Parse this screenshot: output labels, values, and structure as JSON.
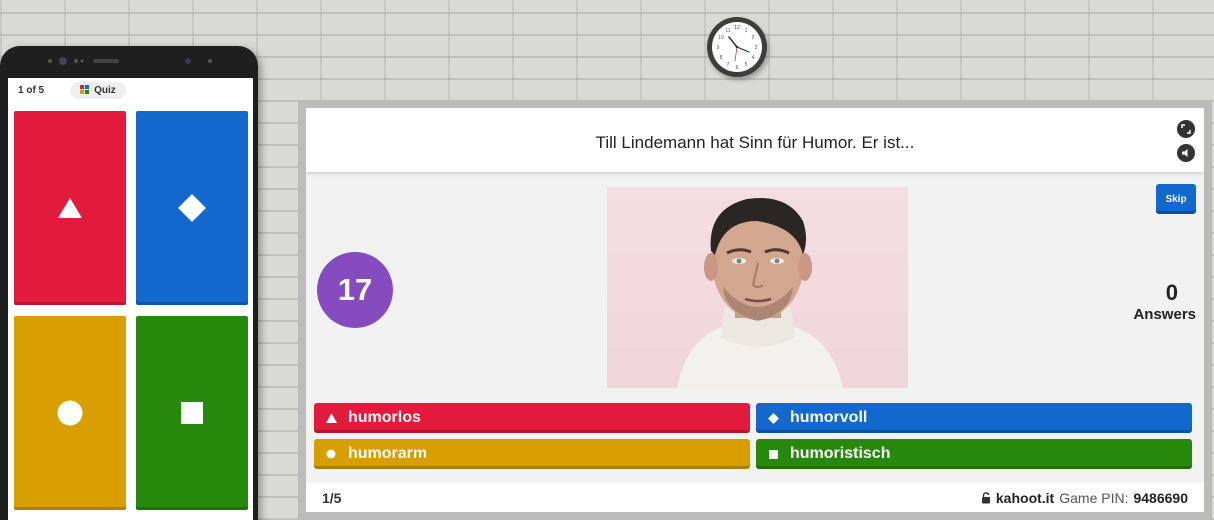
{
  "phone": {
    "progress": "1 of 5",
    "quiz_label": "Quiz",
    "tiles": [
      {
        "color": "#e21b3c",
        "shape": "triangle-icon"
      },
      {
        "color": "#1368ce",
        "shape": "diamond-icon"
      },
      {
        "color": "#d89e00",
        "shape": "circle-icon"
      },
      {
        "color": "#26890c",
        "shape": "square-icon"
      }
    ]
  },
  "main": {
    "question": "Till Lindemann hat Sinn für Humor. Er ist...",
    "skip_label": "Skip",
    "timer": "17",
    "answers_count": "0",
    "answers_label": "Answers",
    "options": [
      {
        "label": "humorlos",
        "color": "#e21b3c",
        "icon": "triangle-icon"
      },
      {
        "label": "humorvoll",
        "color": "#1368ce",
        "icon": "diamond-icon"
      },
      {
        "label": "humorarm",
        "color": "#d89e00",
        "icon": "circle-icon"
      },
      {
        "label": "humoristisch",
        "color": "#26890c",
        "icon": "square-icon"
      }
    ]
  },
  "footer": {
    "progress": "1/5",
    "domain": "kahoot.it",
    "pin_label": "Game PIN:",
    "pin": "9486690"
  },
  "colors": {
    "red": "#e21b3c",
    "blue": "#1368ce",
    "yellow": "#d89e00",
    "green": "#26890c",
    "purple": "#864cbf"
  }
}
